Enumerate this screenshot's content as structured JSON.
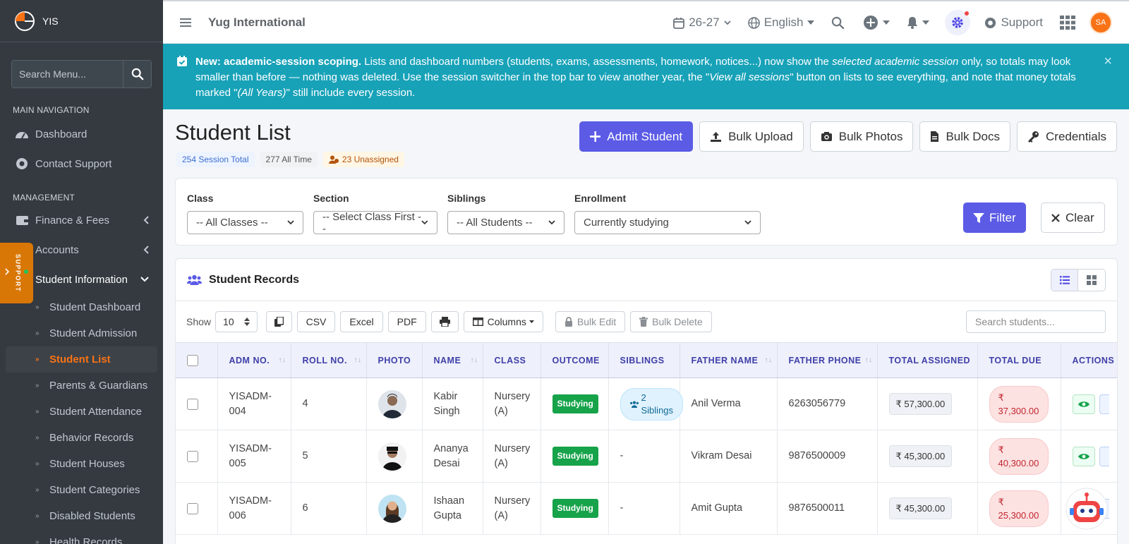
{
  "brand": {
    "name": "YIS"
  },
  "sidebar": {
    "search_placeholder": "Search Menu...",
    "header_main": "MAIN NAVIGATION",
    "main_items": [
      {
        "label": "Dashboard",
        "icon": "dashboard-icon"
      },
      {
        "label": "Contact Support",
        "icon": "support-icon"
      }
    ],
    "header_management": "MANAGEMENT",
    "management_items": [
      {
        "label": "Finance & Fees",
        "icon": "wallet-icon"
      },
      {
        "label": "Accounts",
        "icon": "accounts-icon"
      },
      {
        "label": "Student Information",
        "icon": "student-icon"
      }
    ],
    "sub_items": [
      {
        "label": "Student Dashboard"
      },
      {
        "label": "Student Admission"
      },
      {
        "label": "Student List"
      },
      {
        "label": "Parents & Guardians"
      },
      {
        "label": "Student Attendance"
      },
      {
        "label": "Behavior Records"
      },
      {
        "label": "Student Houses"
      },
      {
        "label": "Student Categories"
      },
      {
        "label": "Disabled Students"
      },
      {
        "label": "Health Records"
      }
    ],
    "support_tab": "SUPPORT"
  },
  "topbar": {
    "school_name": "Yug International",
    "session": "26-27",
    "language": "English",
    "support": "Support",
    "avatar_initials": "SA"
  },
  "alert": {
    "bold": "New: academic-session scoping.",
    "t1": " Lists and dashboard numbers (students, exams, assessments, homework, notices...) now show the ",
    "i1": "selected academic session",
    "t2": " only, so totals may look smaller than before — nothing was deleted. Use the session switcher in the top bar to view another year, the \"",
    "i2": "View all sessions",
    "t3": "\" button on lists to see everything, and note that money totals marked \"",
    "i3": "(All Years)",
    "t4": "\" still include every session."
  },
  "page": {
    "title": "Student List",
    "badges": {
      "session_total": "254 Session Total",
      "all_time": "277 All Time",
      "unassigned": "23 Unassigned"
    },
    "actions": {
      "admit": "Admit Student",
      "bulk_upload": "Bulk Upload",
      "bulk_photos": "Bulk Photos",
      "bulk_docs": "Bulk Docs",
      "credentials": "Credentials"
    }
  },
  "filters": {
    "class_label": "Class",
    "class_value": "-- All Classes --",
    "section_label": "Section",
    "section_value": "-- Select Class First --",
    "siblings_label": "Siblings",
    "siblings_value": "-- All Students --",
    "enrollment_label": "Enrollment",
    "enrollment_value": "Currently studying",
    "filter_btn": "Filter",
    "clear_btn": "Clear"
  },
  "records": {
    "title": "Student Records",
    "show_label": "Show",
    "page_size": "10",
    "csv": "CSV",
    "excel": "Excel",
    "pdf": "PDF",
    "columns": "Columns",
    "bulk_edit": "Bulk Edit",
    "bulk_delete": "Bulk Delete",
    "search_placeholder": "Search students...",
    "headers": {
      "adm_no": "ADM NO.",
      "roll_no": "ROLL NO.",
      "photo": "PHOTO",
      "name": "NAME",
      "class": "CLASS",
      "outcome": "OUTCOME",
      "siblings": "SIBLINGS",
      "father_name": "FATHER NAME",
      "father_phone": "FATHER PHONE",
      "total_assigned": "TOTAL ASSIGNED",
      "total_due": "TOTAL DUE",
      "actions": "ACTIONS"
    },
    "rows": [
      {
        "adm": "YISADM-004",
        "roll": "4",
        "name": "Kabir Singh",
        "class": "Nursery (A)",
        "outcome": "Studying",
        "siblings": "2 Siblings",
        "father": "Anil Verma",
        "phone": "6263056779",
        "assigned": "₹ 57,300.00",
        "due": "₹ 37,300.00"
      },
      {
        "adm": "YISADM-005",
        "roll": "5",
        "name": "Ananya Desai",
        "class": "Nursery (A)",
        "outcome": "Studying",
        "siblings": "-",
        "father": "Vikram Desai",
        "phone": "9876500009",
        "assigned": "₹ 45,300.00",
        "due": "₹ 40,300.00"
      },
      {
        "adm": "YISADM-006",
        "roll": "6",
        "name": "Ishaan Gupta",
        "class": "Nursery (A)",
        "outcome": "Studying",
        "siblings": "-",
        "father": "Amit Gupta",
        "phone": "9876500011",
        "assigned": "₹ 45,300.00",
        "due": "₹ 25,300.00"
      }
    ]
  }
}
